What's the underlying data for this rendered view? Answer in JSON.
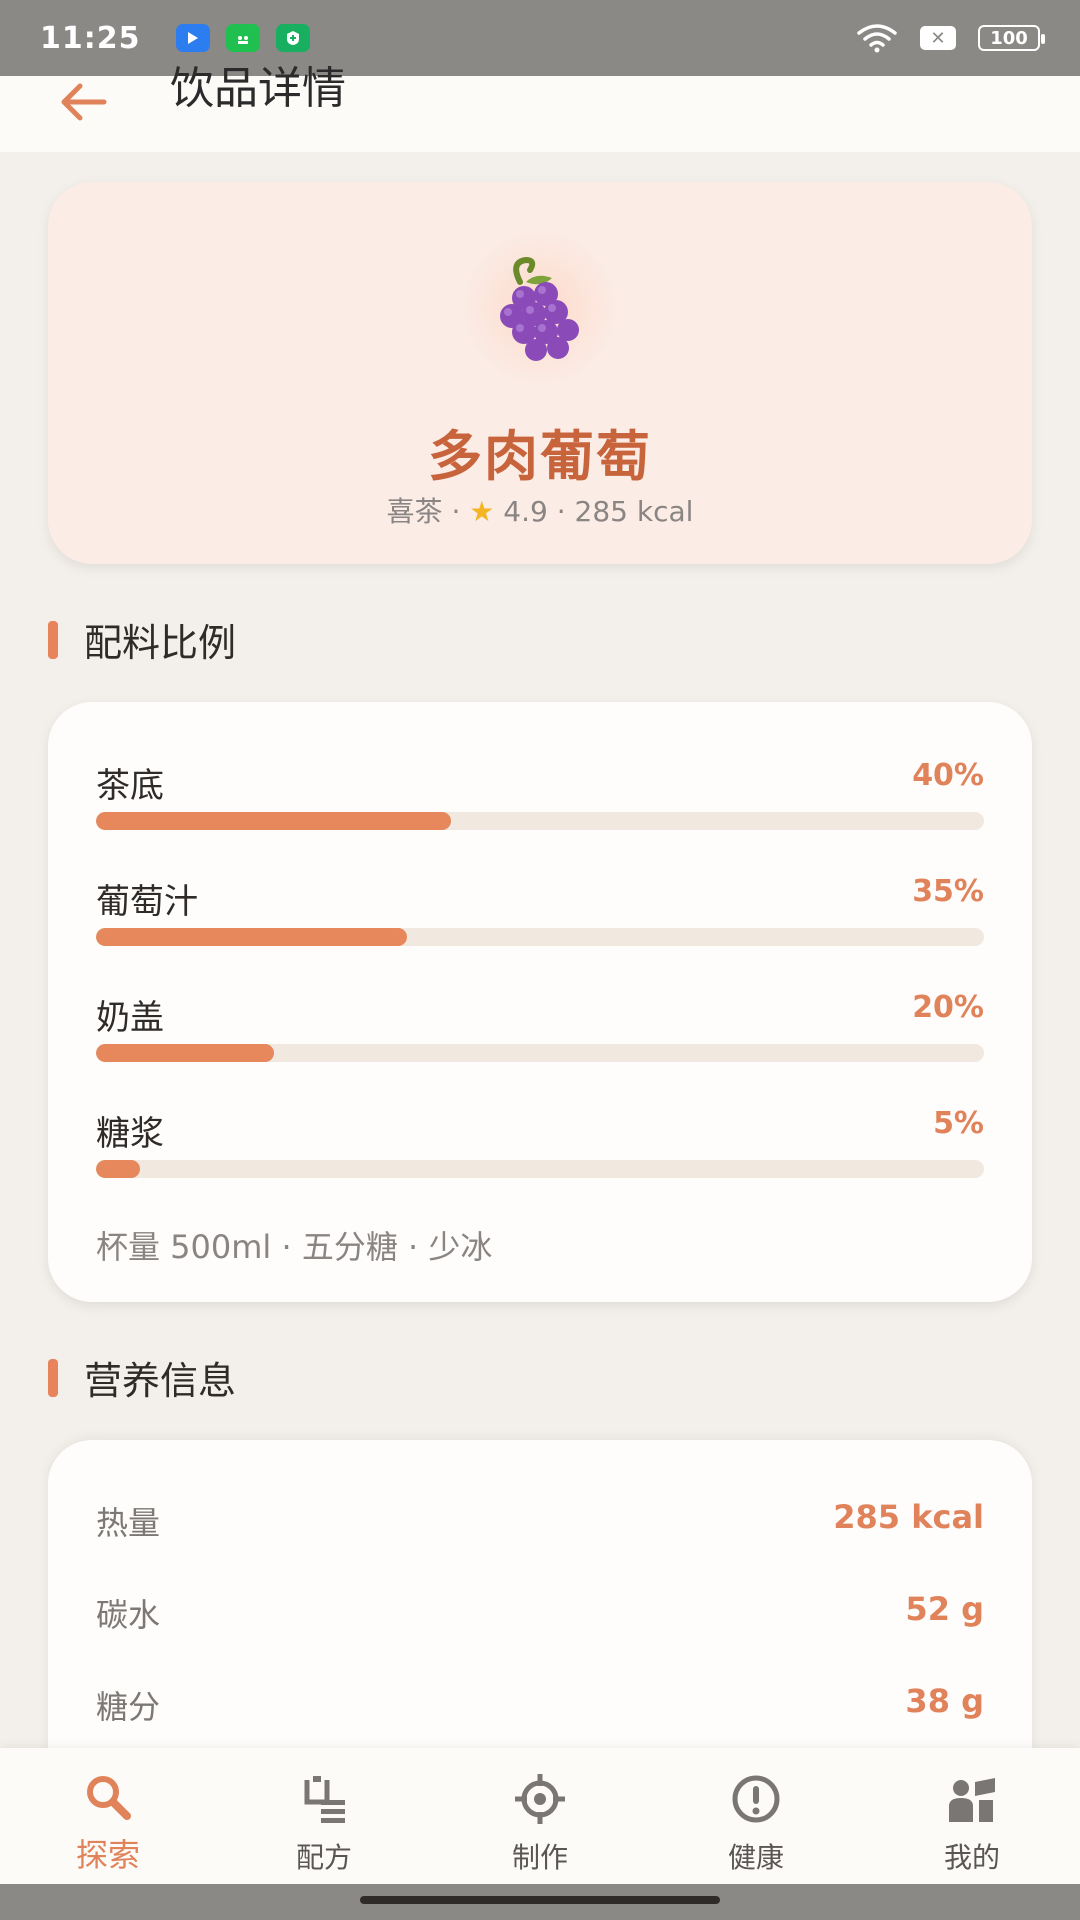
{
  "status_bar": {
    "time": "11:25",
    "battery": "100"
  },
  "header": {
    "title": "饮品详情"
  },
  "drink": {
    "name": "多肉葡萄",
    "brand": "喜茶",
    "rating": "4.9",
    "calories": "285 kcal",
    "icon": "grape-icon"
  },
  "ingredients": {
    "title": "配料比例",
    "items": [
      {
        "name": "茶底",
        "pct_label": "40%",
        "pct": 40
      },
      {
        "name": "葡萄汁",
        "pct_label": "35%",
        "pct": 35
      },
      {
        "name": "奶盖",
        "pct_label": "20%",
        "pct": 20
      },
      {
        "name": "糖浆",
        "pct_label": "5%",
        "pct": 5
      }
    ],
    "cup_info": "杯量 500ml · 五分糖 · 少冰"
  },
  "nutrition": {
    "title": "营养信息",
    "items": [
      {
        "label": "热量",
        "value": "285 kcal"
      },
      {
        "label": "碳水",
        "value": "52 g"
      },
      {
        "label": "糖分",
        "value": "38 g"
      }
    ]
  },
  "nav": {
    "items": [
      {
        "label": "探索",
        "icon": "search-icon",
        "active": true
      },
      {
        "label": "配方",
        "icon": "recipe-icon",
        "active": false
      },
      {
        "label": "制作",
        "icon": "target-icon",
        "active": false
      },
      {
        "label": "健康",
        "icon": "info-icon",
        "active": false
      },
      {
        "label": "我的",
        "icon": "profile-icon",
        "active": false
      }
    ]
  },
  "colors": {
    "accent": "#e0825a",
    "title_accent": "#c8643c",
    "card_hero": "#fbece6",
    "background": "#f3efea"
  }
}
